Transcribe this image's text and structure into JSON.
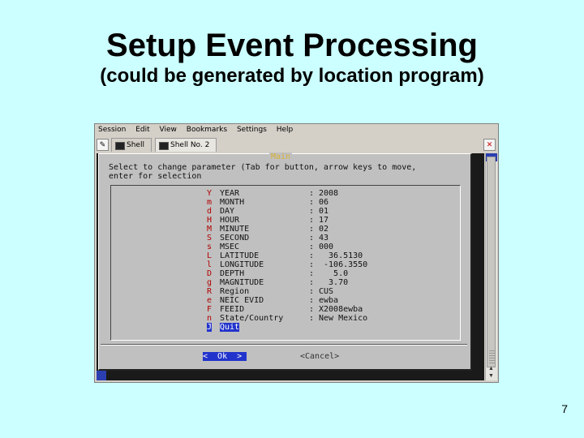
{
  "slide": {
    "title": "Setup Event Processing",
    "subtitle": "(could be generated by location program)",
    "page_number": "7"
  },
  "window": {
    "menu": [
      "Session",
      "Edit",
      "View",
      "Bookmarks",
      "Settings",
      "Help"
    ],
    "tabs": [
      {
        "label": "Shell",
        "active": false
      },
      {
        "label": "Shell No. 2",
        "active": true
      }
    ]
  },
  "dialog": {
    "title": "Main",
    "instructions_line1": "Select to change parameter (Tab for button, arrow keys to move,",
    "instructions_line2": "enter for selection",
    "rows": [
      {
        "key": "Y",
        "name": "YEAR",
        "value": "2008"
      },
      {
        "key": "m",
        "name": "MONTH",
        "value": "06"
      },
      {
        "key": "d",
        "name": "DAY",
        "value": "01"
      },
      {
        "key": "H",
        "name": "HOUR",
        "value": "17"
      },
      {
        "key": "M",
        "name": "MINUTE",
        "value": "02"
      },
      {
        "key": "S",
        "name": "SECOND",
        "value": "43"
      },
      {
        "key": "s",
        "name": "MSEC",
        "value": "000"
      },
      {
        "key": "L",
        "name": "LATITUDE",
        "value": "  36.5130"
      },
      {
        "key": "l",
        "name": "LONGITUDE",
        "value": " -106.3550"
      },
      {
        "key": "D",
        "name": "DEPTH",
        "value": "   5.0"
      },
      {
        "key": "g",
        "name": "MAGNITUDE",
        "value": "  3.70"
      },
      {
        "key": "R",
        "name": "Region",
        "value": "CUS"
      },
      {
        "key": "e",
        "name": "NEIC EVID",
        "value": "ewba"
      },
      {
        "key": "F",
        "name": "FEEID",
        "value": "X2008ewba"
      },
      {
        "key": "n",
        "name": "State/Country",
        "value": "New Mexico"
      },
      {
        "key": "J",
        "name": "Quit",
        "value": "",
        "selected": true
      }
    ],
    "ok_label": "<  Ok  >",
    "cancel_label": "<Cancel>"
  }
}
